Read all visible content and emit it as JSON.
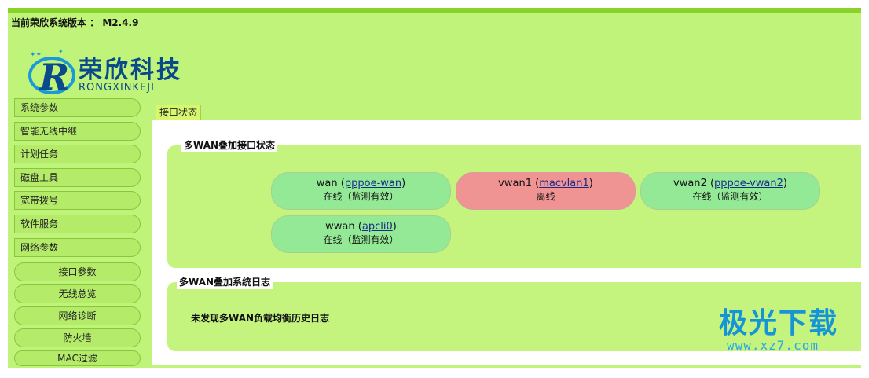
{
  "header": {
    "version_text": "当前荣欣系统版本 ： M2.4.9",
    "logo_cn": "荣欣科技",
    "logo_en": "RONGXINKEJI"
  },
  "sidebar": {
    "items": [
      {
        "label": "系统参数"
      },
      {
        "label": "智能无线中继"
      },
      {
        "label": "计划任务"
      },
      {
        "label": "磁盘工具"
      },
      {
        "label": "宽带拨号"
      },
      {
        "label": "软件服务"
      },
      {
        "label": "网络参数"
      }
    ],
    "sub_items": [
      {
        "label": "接口参数"
      },
      {
        "label": "无线总览"
      },
      {
        "label": "网络诊断"
      },
      {
        "label": "防火墙"
      },
      {
        "label": "MAC过滤"
      }
    ]
  },
  "main": {
    "tab_label": "接口状态",
    "status_section": {
      "title": "多WAN叠加接口状态",
      "interfaces": [
        {
          "name": "wan",
          "link": "pppoe-wan",
          "status": "在线（监测有效）",
          "state": "online"
        },
        {
          "name": "vwan1",
          "link": "macvlan1",
          "status": "离线",
          "state": "offline"
        },
        {
          "name": "vwan2",
          "link": "pppoe-vwan2",
          "status": "在线（监测有效）",
          "state": "online"
        },
        {
          "name": "wwan",
          "link": "apcli0",
          "status": "在线（监测有效）",
          "state": "online"
        }
      ]
    },
    "log_section": {
      "title": "多WAN叠加系统日志",
      "message": "未发现多WAN负载均衡历史日志"
    }
  },
  "watermark": {
    "main": "极光下载",
    "url": "www.xz7.com"
  },
  "colors": {
    "background": "#c0f37a",
    "top_bar": "#88d22a",
    "online": "#93e996",
    "offline": "#ef9393",
    "link": "#1a2a8a",
    "logo": "#0b4a8a",
    "watermark": "#1694d8"
  }
}
